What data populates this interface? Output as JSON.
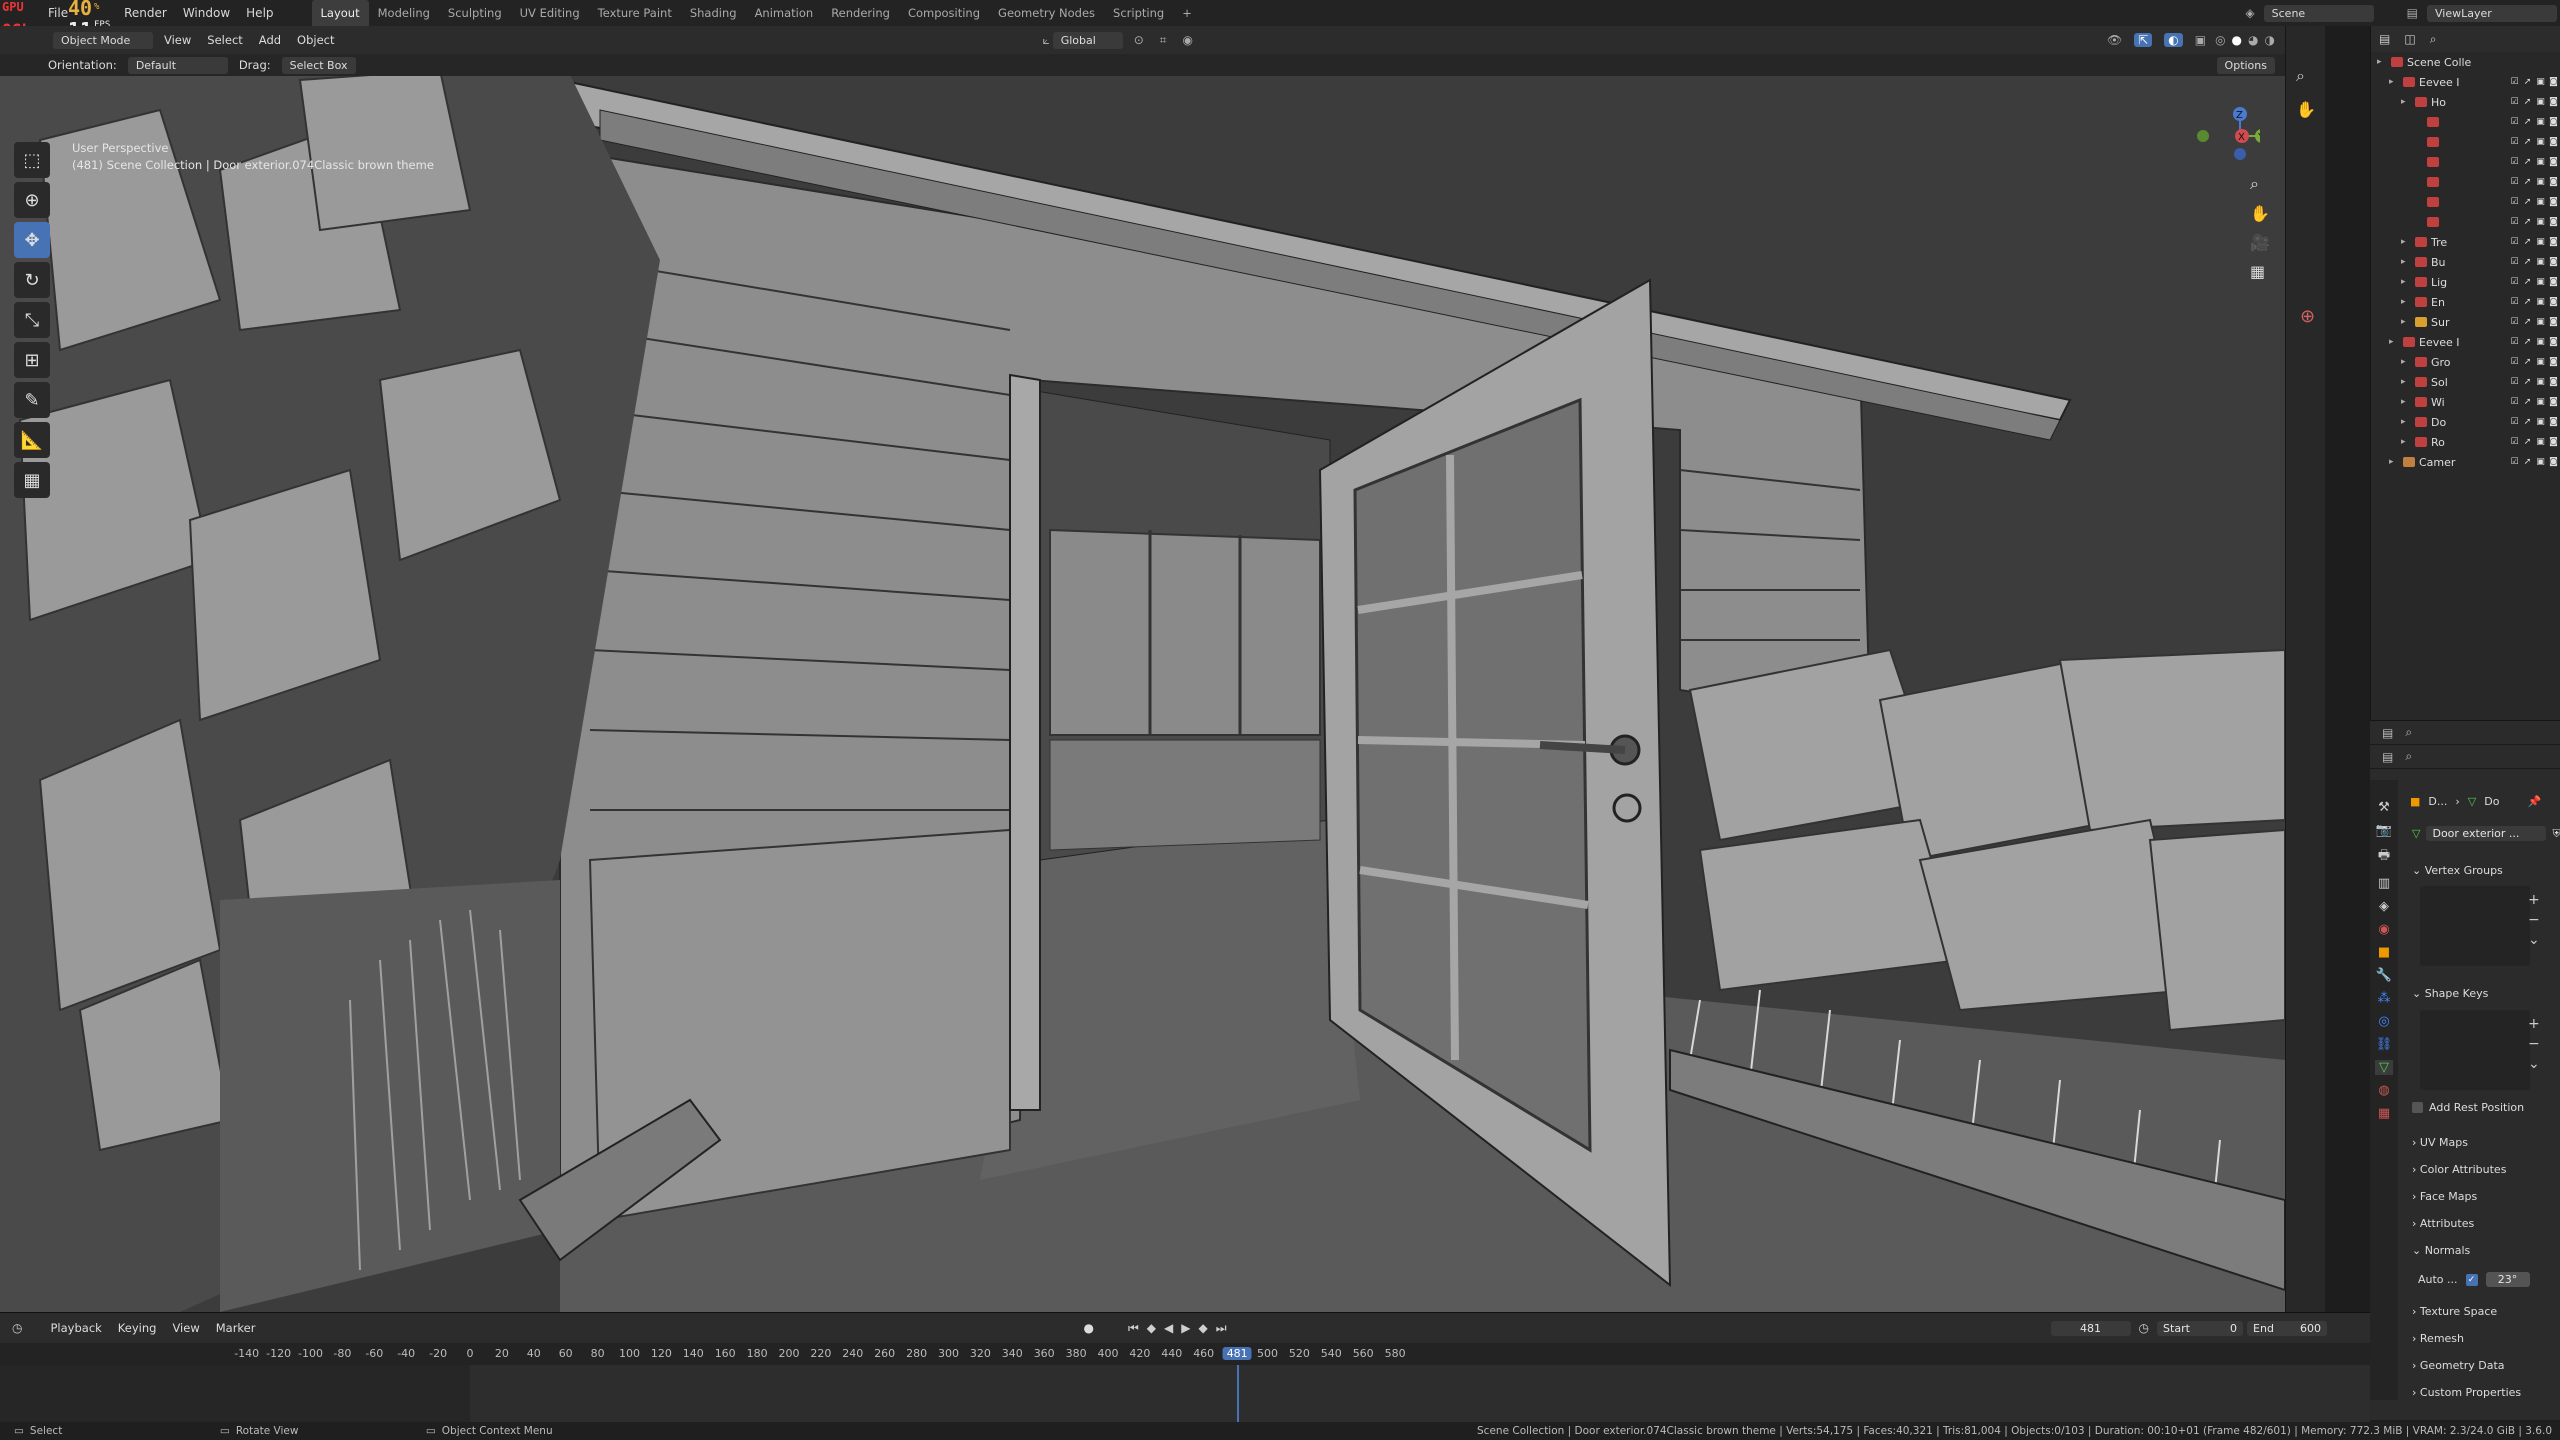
{
  "topbar": {
    "menus": [
      "File",
      "Render",
      "Window",
      "Help"
    ],
    "workspaces": [
      "Layout",
      "Modeling",
      "Sculpting",
      "UV Editing",
      "Texture Paint",
      "Shading",
      "Animation",
      "Rendering",
      "Compositing",
      "Geometry Nodes",
      "Scripting"
    ],
    "active_workspace": "Layout",
    "add_tab": "+",
    "scene_label": "Scene",
    "viewlayer_label": "ViewLayer"
  },
  "overlay": {
    "gpu": "GPU",
    "gpu_value": "40",
    "gpu_unit": "%",
    "ogl": "OGL",
    "fps_value": "11",
    "fps_label": "FPS"
  },
  "viewport_header": {
    "mode": "Object Mode",
    "menus": [
      "View",
      "Select",
      "Add",
      "Object"
    ],
    "transform": "Global",
    "options": "Options"
  },
  "tool_settings": {
    "orientation_label": "Orientation:",
    "orientation_value": "Default",
    "drag_label": "Drag:",
    "drag_value": "Select Box"
  },
  "viewport_info": {
    "line1": "User Perspective",
    "line2": "(481) Scene Collection | Door exterior.074Classic brown theme"
  },
  "gizmo": {
    "axis_x": "X",
    "axis_y": "Y",
    "axis_z": "Z"
  },
  "outliner": {
    "rows": [
      {
        "label": "Scene Colle",
        "depth": 0
      },
      {
        "label": "Eevee I",
        "depth": 1
      },
      {
        "label": "Ho",
        "depth": 2
      },
      {
        "label": "",
        "depth": 3
      },
      {
        "label": "",
        "depth": 3
      },
      {
        "label": "",
        "depth": 3
      },
      {
        "label": "",
        "depth": 3
      },
      {
        "label": "",
        "depth": 3
      },
      {
        "label": "",
        "depth": 3
      },
      {
        "label": "Tre",
        "depth": 2
      },
      {
        "label": "Bu",
        "depth": 2
      },
      {
        "label": "Lig",
        "depth": 2
      },
      {
        "label": "En",
        "depth": 2
      },
      {
        "label": "Sur",
        "depth": 2
      },
      {
        "label": "Eevee I",
        "depth": 1
      },
      {
        "label": "Gro",
        "depth": 2
      },
      {
        "label": "Sol",
        "depth": 2
      },
      {
        "label": "Wi",
        "depth": 2
      },
      {
        "label": "Do",
        "depth": 2
      },
      {
        "label": "Ro",
        "depth": 2
      },
      {
        "label": "Camer",
        "depth": 1
      }
    ]
  },
  "properties": {
    "breadcrumb_obj": "D...",
    "breadcrumb_data": "Do",
    "datablock": "Door exterior ...",
    "vertex_groups": "Vertex Groups",
    "shape_keys": "Shape Keys",
    "add_rest_position": "Add Rest Position",
    "sections": [
      "UV Maps",
      "Color Attributes",
      "Face Maps",
      "Attributes",
      "Normals"
    ],
    "auto_smooth": "Auto ...",
    "auto_smooth_angle": "23°",
    "sections2": [
      "Texture Space",
      "Remesh",
      "Geometry Data",
      "Custom Properties"
    ]
  },
  "timeline": {
    "menus": [
      "Playback",
      "Keying",
      "View",
      "Marker"
    ],
    "current_frame": "481",
    "start_label": "Start",
    "start": "0",
    "end_label": "End",
    "end": "600",
    "ticks": [
      "-140",
      "-120",
      "-100",
      "-80",
      "-60",
      "-40",
      "-20",
      "0",
      "20",
      "40",
      "60",
      "80",
      "100",
      "120",
      "140",
      "160",
      "180",
      "200",
      "220",
      "240",
      "260",
      "280",
      "300",
      "320",
      "340",
      "360",
      "380",
      "400",
      "420",
      "440",
      "460",
      "481",
      "500",
      "520",
      "540",
      "560",
      "580"
    ]
  },
  "statusbar": {
    "select": "Select",
    "rotate": "Rotate View",
    "context": "Object Context Menu",
    "stats": "Scene Collection | Door exterior.074Classic brown theme | Verts:54,175 | Faces:40,321 | Tris:81,004 | Objects:0/103 | Duration: 00:10+01 (Frame 482/601) | Memory: 772.3 MiB | VRAM: 2.3/24.0 GiB | 3.6.0"
  },
  "colors": {
    "accent": "#4772b3",
    "frame_marker": "#4772b3",
    "viewport_bg": "#3b3b3b"
  }
}
